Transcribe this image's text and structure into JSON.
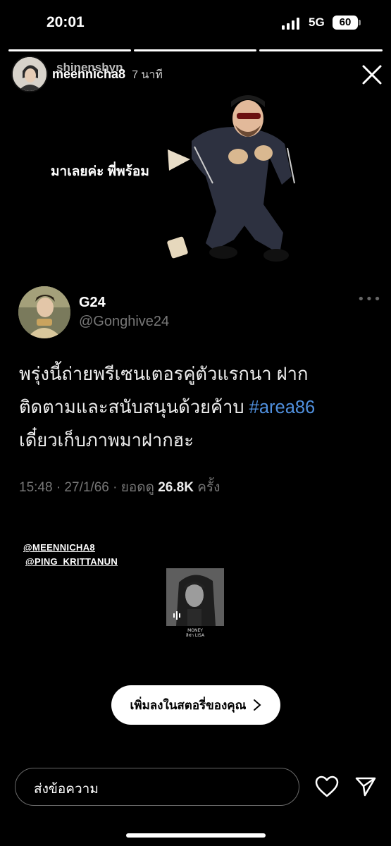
{
  "status_bar": {
    "time": "20:01",
    "network": "5G",
    "battery": "60"
  },
  "story": {
    "progress_segments": 3,
    "active_segment": 1,
    "username_back": "shinenshyn",
    "username": "meennicha8",
    "time_suffix": "7 นาที",
    "sticker_text": "มาเลยค่ะ พี่พร้อม"
  },
  "tweet": {
    "display_name": "G24",
    "handle": "@Gonghive24",
    "text_line1": "พรุ่งนี้ถ่ายพรีเซนเตอรคู่ตัวแรกนา ฝาก",
    "text_line2_prefix": "ติดตามและสนับสนุนด้วยค้าบ",
    "hashtag": "#area86",
    "text_line3": "เดี๋ยวเก็บภาพมาฝากฮะ",
    "time": "15:48 · 27/1/66 · ยอดดู",
    "views": "26.8K",
    "views_suffix": "ครั้ง"
  },
  "mentions": [
    "@MEENNICHA8",
    "@PING_KRITTANUN"
  ],
  "music": {
    "title": "MONEY",
    "artist": "ลิซ่า LISA"
  },
  "add_to_story": {
    "label": "เพิ่มลงในสตอรี่ของคุณ"
  },
  "bottom_bar": {
    "reply_placeholder": "ส่งข้อความ"
  },
  "colors": {
    "background": "#000000",
    "hashtag": "#4f8fdd",
    "muted": "#777777"
  }
}
